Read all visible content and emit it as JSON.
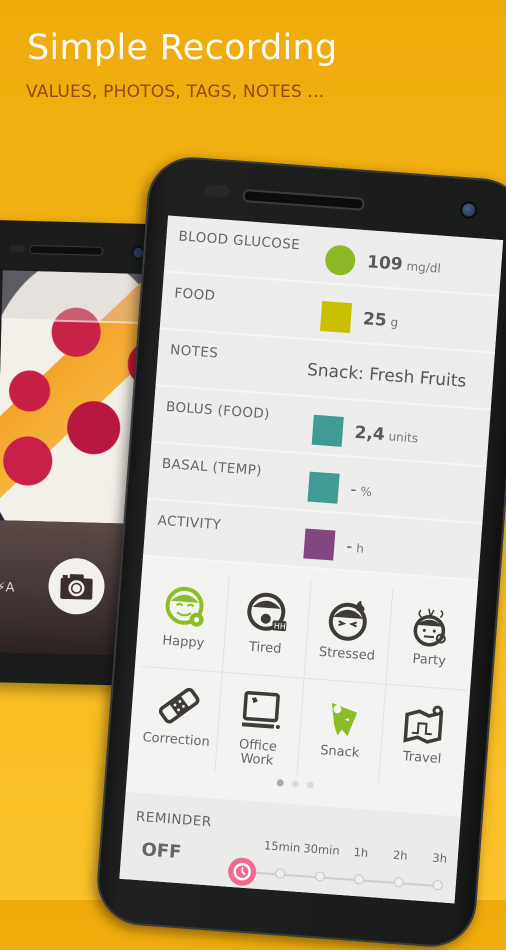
{
  "promo": {
    "title": "Simple Recording",
    "subtitle": "VALUES, PHOTOS, TAGS, NOTES ..."
  },
  "colors": {
    "background": "#f2b414",
    "subtitle": "#8f4a12",
    "glucose": "#8db927",
    "food": "#c9bf00",
    "bolus": "#3f9c95",
    "basal": "#3f9c95",
    "activity": "#844683",
    "tag_accent": "#8dbd26",
    "reminder_accent": "#ee6c8e"
  },
  "back_phone": {
    "next_icon": "chevron-right-icon",
    "flash_label": "⚡A",
    "shutter_icon": "camera-icon"
  },
  "entries": [
    {
      "label": "BLOOD GLUCOSE",
      "value": "109",
      "unit": "mg/dl",
      "shape": "circle"
    },
    {
      "label": "FOOD",
      "value": "25",
      "unit": "g",
      "shape": "square"
    },
    {
      "label": "NOTES",
      "value": "Snack: Fresh Fruits",
      "unit": "",
      "shape": "none"
    },
    {
      "label": "BOLUS (FOOD)",
      "value": "2,4",
      "unit": "units",
      "shape": "square"
    },
    {
      "label": "BASAL (TEMP)",
      "value": "-",
      "unit": "%",
      "shape": "square"
    },
    {
      "label": "ACTIVITY",
      "value": "-",
      "unit": "h",
      "shape": "square"
    }
  ],
  "tags": [
    {
      "label": "Happy",
      "icon": "happy-face-icon",
      "selected": true
    },
    {
      "label": "Tired",
      "icon": "tired-face-icon",
      "selected": false
    },
    {
      "label": "Stressed",
      "icon": "stressed-face-icon",
      "selected": false
    },
    {
      "label": "Party",
      "icon": "party-face-icon",
      "selected": false
    },
    {
      "label": "Correction",
      "icon": "bandage-icon",
      "selected": false
    },
    {
      "label": "Office\nWork",
      "icon": "computer-icon",
      "selected": false
    },
    {
      "label": "Snack",
      "icon": "pizza-icon",
      "selected": true
    },
    {
      "label": "Travel",
      "icon": "map-icon",
      "selected": false
    }
  ],
  "pagination": {
    "pages": 3,
    "current": 1
  },
  "reminder": {
    "label": "REMINDER",
    "state": "OFF",
    "options": [
      "15min",
      "30min",
      "1h",
      "2h",
      "3h"
    ],
    "selected_index": -1
  }
}
